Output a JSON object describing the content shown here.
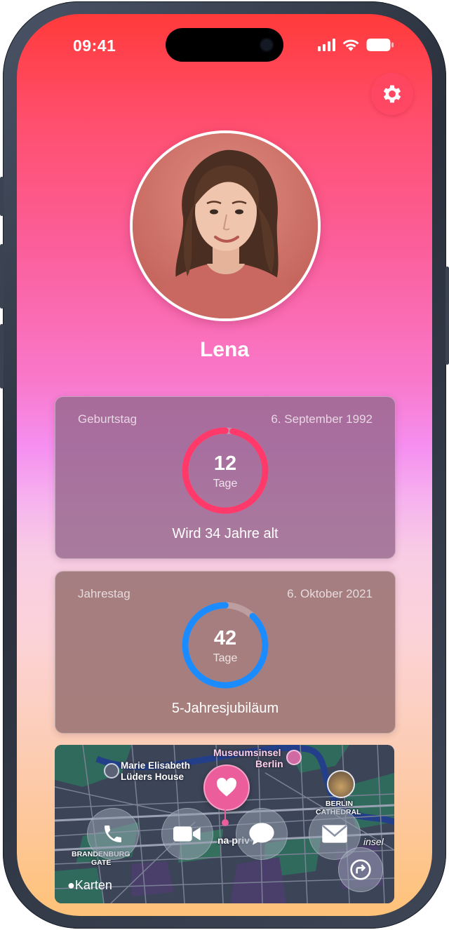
{
  "status_bar": {
    "time": "09:41",
    "icons": [
      "cellular-signal-icon",
      "wifi-icon",
      "battery-icon"
    ]
  },
  "header": {
    "settings_icon": "gear-icon"
  },
  "profile": {
    "name": "Lena",
    "avatar_icon": "profile-photo"
  },
  "cards": {
    "birthday": {
      "label": "Geburtstag",
      "date": "6. September 1992",
      "days": "12",
      "unit": "Tage",
      "subtitle": "Wird 34 Jahre alt",
      "ring_color": "#ff3a6a",
      "progress": 0.97
    },
    "anniversary": {
      "label": "Jahrestag",
      "date": "6. Oktober 2021",
      "days": "42",
      "unit": "Tage",
      "subtitle": "5-Jahresjubiläum",
      "ring_color": "#1a8cff",
      "progress": 0.88
    }
  },
  "map": {
    "labels": {
      "museum": "Museumsinsel",
      "museum_city": "Berlin",
      "house_1": "Marie Elisabeth",
      "house_2": "Lüders House",
      "cathedral_1": "BERLIN",
      "cathedral_2": "CATHEDRAL",
      "gate_1": "BRANDENBURG",
      "gate_2": "GATE",
      "street": "na priv",
      "insel": "insel",
      "attribution": "Karten"
    },
    "actions": [
      {
        "name": "call",
        "icon": "phone-icon"
      },
      {
        "name": "video",
        "icon": "video-camera-icon"
      },
      {
        "name": "message",
        "icon": "chat-bubble-icon"
      },
      {
        "name": "mail",
        "icon": "envelope-icon"
      }
    ],
    "pin_icon": "heart-icon",
    "share_icon": "share-arrow-icon"
  },
  "colors": {
    "gradient_top": "#ff3a3a",
    "gradient_mid": "#f58ff0",
    "gradient_bottom": "#ffc278",
    "accent_red": "#ff3a6a",
    "accent_blue": "#1a8cff"
  }
}
